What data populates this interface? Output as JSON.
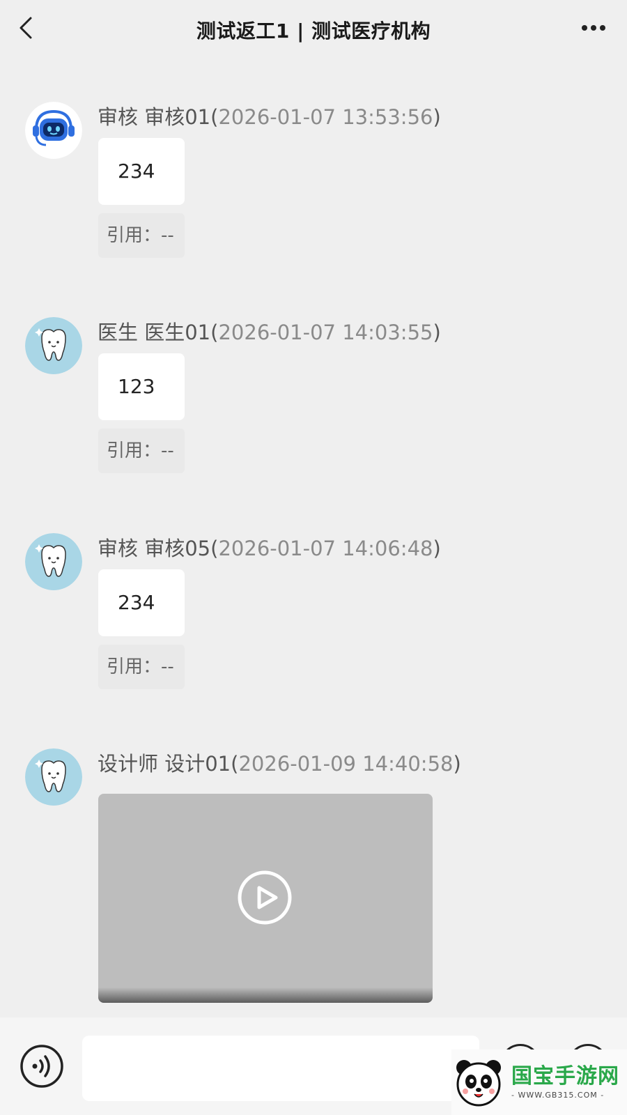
{
  "header": {
    "title": "测试返工1 | 测试医疗机构",
    "back_icon": "chevron-left-icon",
    "more_icon": "more-horizontal-icon"
  },
  "messages": [
    {
      "role": "审核",
      "name": "审核01",
      "time": "2026-01-07 13:53:56",
      "text": "234",
      "quote": "引用：--",
      "avatar": "robot-avatar"
    },
    {
      "role": "医生",
      "name": "医生01",
      "time": "2026-01-07 14:03:55",
      "text": "123",
      "quote": "引用：--",
      "avatar": "tooth-avatar"
    },
    {
      "role": "审核",
      "name": "审核05",
      "time": "2026-01-07 14:06:48",
      "text": "234",
      "quote": "引用：--",
      "avatar": "tooth-avatar"
    },
    {
      "role": "设计师",
      "name": "设计01",
      "time": "2026-01-09 14:40:58",
      "type": "video",
      "avatar": "tooth-avatar"
    }
  ],
  "bottom": {
    "voice_icon": "voice-icon",
    "input_value": "",
    "input_placeholder": ""
  },
  "watermark": {
    "brand": "国宝手游网",
    "url": "- WWW.GB315.COM -"
  },
  "colors": {
    "background": "#efefef",
    "bubble": "#ffffff",
    "robot_blue": "#2f6fe0",
    "tooth_bg": "#a9d6e6"
  }
}
